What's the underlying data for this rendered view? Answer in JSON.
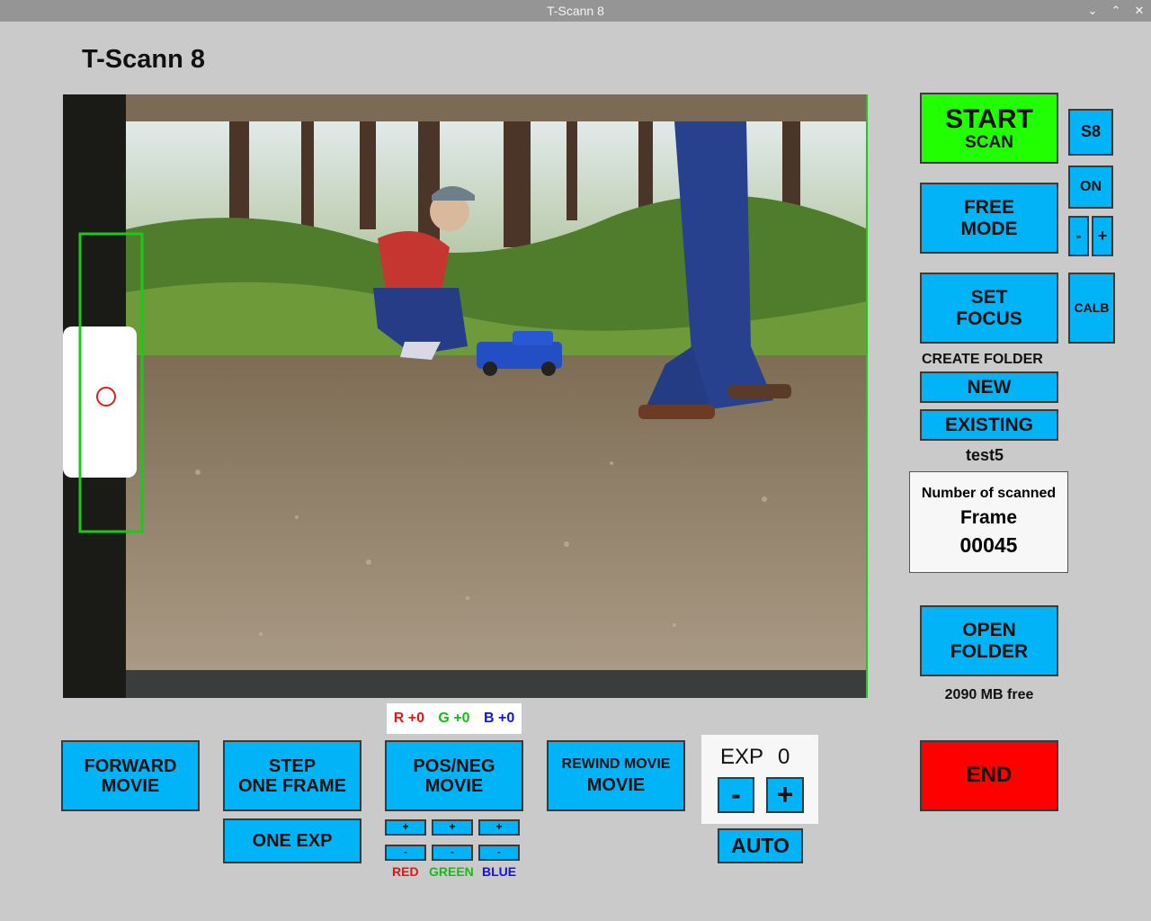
{
  "window": {
    "title": "T-Scann 8",
    "minimize": "⌄",
    "maximize": "⌃",
    "close": "✕"
  },
  "app": {
    "title": "T-Scann 8"
  },
  "preview": {},
  "right_panel": {
    "start": {
      "line1": "START",
      "line2": "SCAN"
    },
    "s8": "S8",
    "on": "ON",
    "minus": "-",
    "plus": "+",
    "free_mode": {
      "line1": "FREE",
      "line2": "MODE"
    },
    "set_focus": {
      "line1": "SET",
      "line2": "FOCUS"
    },
    "calb": "CALB",
    "create_folder_label": "CREATE FOLDER",
    "new": "NEW",
    "existing": "EXISTING",
    "folder_name": "test5",
    "counter": {
      "line1": "Number of scanned",
      "line2": "Frame",
      "value": "00045"
    },
    "open_folder": {
      "line1": "OPEN",
      "line2": "FOLDER"
    },
    "free_space": "2090 MB free",
    "end": "END"
  },
  "bottom_panel": {
    "rgb": {
      "r": "R +0",
      "g": "G +0",
      "b": "B +0"
    },
    "forward": {
      "line1": "FORWARD",
      "line2": "MOVIE"
    },
    "step": {
      "line1": "STEP",
      "line2": "ONE FRAME"
    },
    "one_exp": "ONE EXP",
    "posneg": {
      "line1": "POS/NEG",
      "line2": "MOVIE"
    },
    "rewind": {
      "line1": "REWIND MOVIE",
      "line2": "MOVIE"
    },
    "exp": {
      "label": "EXP",
      "value": "0",
      "minus": "-",
      "plus": "+"
    },
    "auto": "AUTO",
    "color_plus": "+",
    "color_minus": "-",
    "color_labels": {
      "red": "RED",
      "green": "GREEN",
      "blue": "BLUE"
    }
  },
  "colors": {
    "accent": "#00b4f7",
    "start": "#22ff00",
    "end": "#ff0000",
    "red": "#ee1111",
    "green": "#10c010",
    "blue": "#1111ee"
  }
}
